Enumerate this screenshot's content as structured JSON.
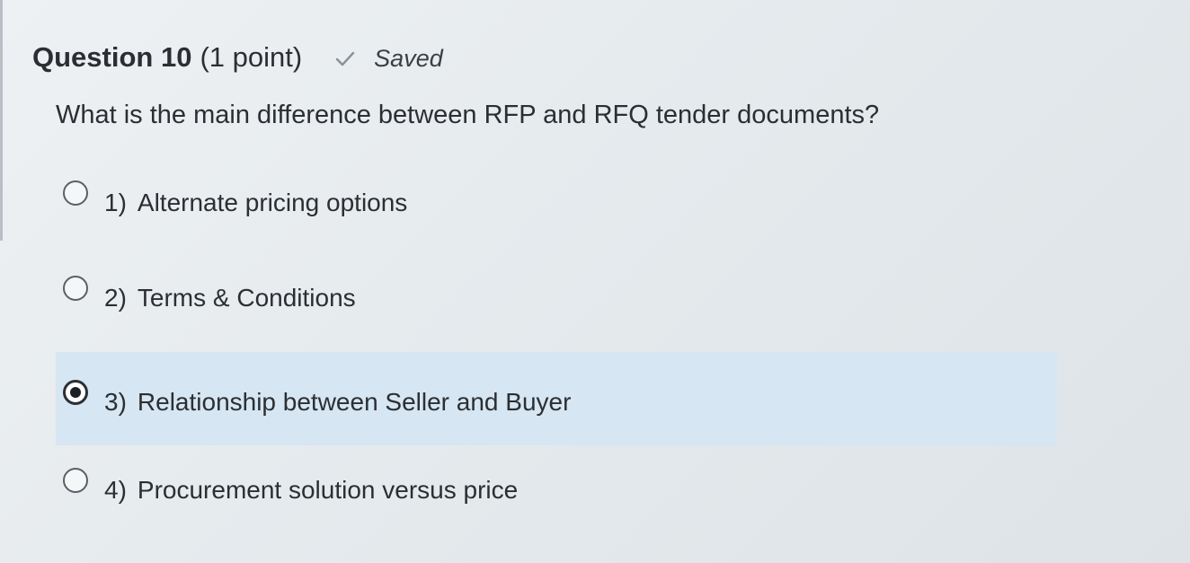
{
  "question": {
    "title": "Question 10",
    "points": "(1 point)",
    "status_icon": "check-icon",
    "status": "Saved",
    "text": "What is the main difference between RFP and RFQ tender documents?"
  },
  "options": [
    {
      "number": "1)",
      "label": "Alternate pricing options",
      "selected": false
    },
    {
      "number": "2)",
      "label": "Terms & Conditions",
      "selected": false
    },
    {
      "number": "3)",
      "label": "Relationship between Seller and Buyer",
      "selected": true
    },
    {
      "number": "4)",
      "label": "Procurement solution versus price",
      "selected": false
    }
  ],
  "colors": {
    "selected_background": "#d6e6f2",
    "text": "#2b2f33"
  }
}
